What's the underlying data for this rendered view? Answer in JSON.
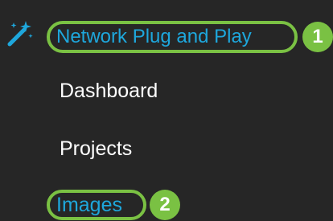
{
  "nav": {
    "header": {
      "icon": "magic-wand-icon",
      "label": "Network Plug and Play",
      "callout": "1"
    },
    "items": [
      {
        "label": "Dashboard",
        "active": false
      },
      {
        "label": "Projects",
        "active": false
      },
      {
        "label": "Images",
        "active": true,
        "callout": "2"
      }
    ]
  },
  "colors": {
    "background": "#262626",
    "link": "#1ea7dc",
    "highlight": "#7ac143",
    "text": "#ffffff"
  }
}
